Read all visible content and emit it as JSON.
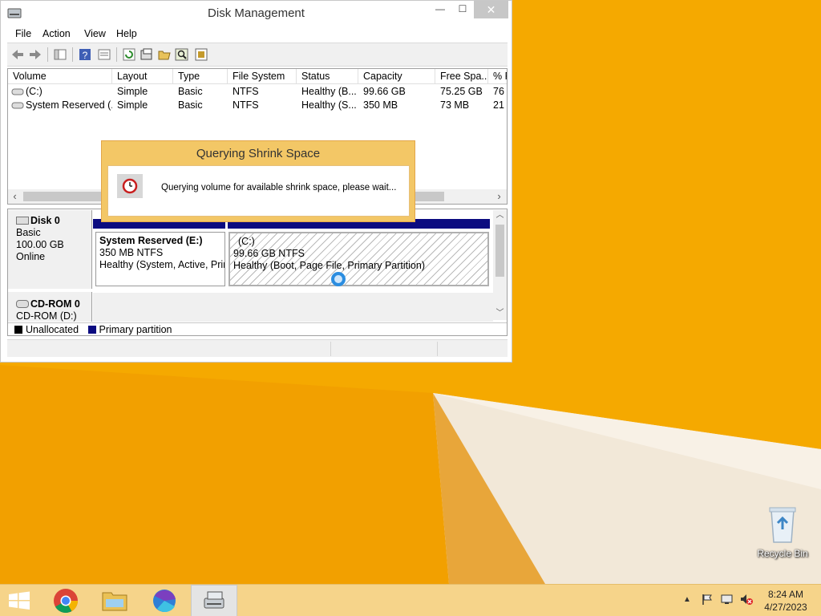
{
  "window": {
    "title": "Disk Management",
    "controls": {
      "minimize": "—",
      "maximize": "☐",
      "close": "✕"
    }
  },
  "menu": [
    "File",
    "Action",
    "View",
    "Help"
  ],
  "volume_list": {
    "columns": [
      "Volume",
      "Layout",
      "Type",
      "File System",
      "Status",
      "Capacity",
      "Free Spa...",
      "% F"
    ],
    "rows": [
      [
        "(C:)",
        "Simple",
        "Basic",
        "NTFS",
        "Healthy (B...",
        "99.66 GB",
        "75.25 GB",
        "76"
      ],
      [
        "System Reserved (...",
        "Simple",
        "Basic",
        "NTFS",
        "Healthy (S...",
        "350 MB",
        "73 MB",
        "21"
      ]
    ]
  },
  "disks": {
    "disk0": {
      "name": "Disk 0",
      "type": "Basic",
      "size": "100.00 GB",
      "state": "Online",
      "partitions": [
        {
          "name": "System Reserved  (E:)",
          "size": "350 MB NTFS",
          "status": "Healthy (System, Active, Prin"
        },
        {
          "name": "(C:)",
          "size": "99.66 GB NTFS",
          "status": "Healthy (Boot, Page File, Primary Partition)"
        }
      ]
    },
    "cdrom0": {
      "name": "CD-ROM 0",
      "drive": "CD-ROM (D:)"
    }
  },
  "legend": [
    {
      "label": "Unallocated",
      "color": "#000000"
    },
    {
      "label": "Primary partition",
      "color": "#0b0b80"
    }
  ],
  "dialog": {
    "title": "Querying Shrink Space",
    "message": "Querying volume for available shrink space, please wait...",
    "icon": "clock-icon"
  },
  "desktop": {
    "recycle_bin": "Recycle Bin"
  },
  "taskbar": {
    "apps": [
      "start-button",
      "chrome-icon",
      "file-explorer-icon",
      "edge-icon",
      "disk-management-icon"
    ],
    "time": "8:24 AM",
    "date": "4/27/2023"
  },
  "colors": {
    "wallpaper": "#f5a900",
    "dialog_frame": "#f3c766",
    "primary_partition": "#0b0b80",
    "taskbar": "#f6d48a"
  }
}
